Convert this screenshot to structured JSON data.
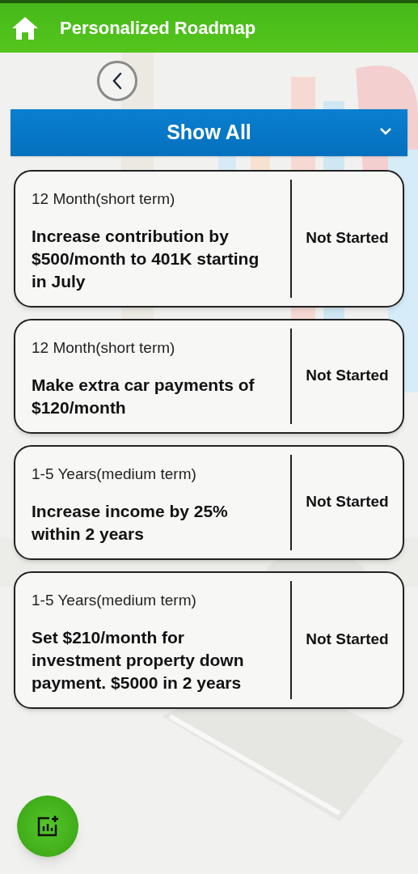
{
  "header": {
    "title": "Personalized Roadmap"
  },
  "filter": {
    "label": "Show All"
  },
  "goals": [
    {
      "term": "12 Month(short term)",
      "title": "Increase contribution by $500/month to 401K starting in July",
      "status": "Not Started"
    },
    {
      "term": "12 Month(short term)",
      "title": "Make extra car payments of $120/month",
      "status": "Not Started"
    },
    {
      "term": "1-5 Years(medium term)",
      "title": "Increase income by 25% within 2 years",
      "status": "Not Started"
    },
    {
      "term": "1-5 Years(medium term)",
      "title": "Set $210/month for investment property down payment. $5000 in 2 years",
      "status": "Not Started"
    }
  ]
}
